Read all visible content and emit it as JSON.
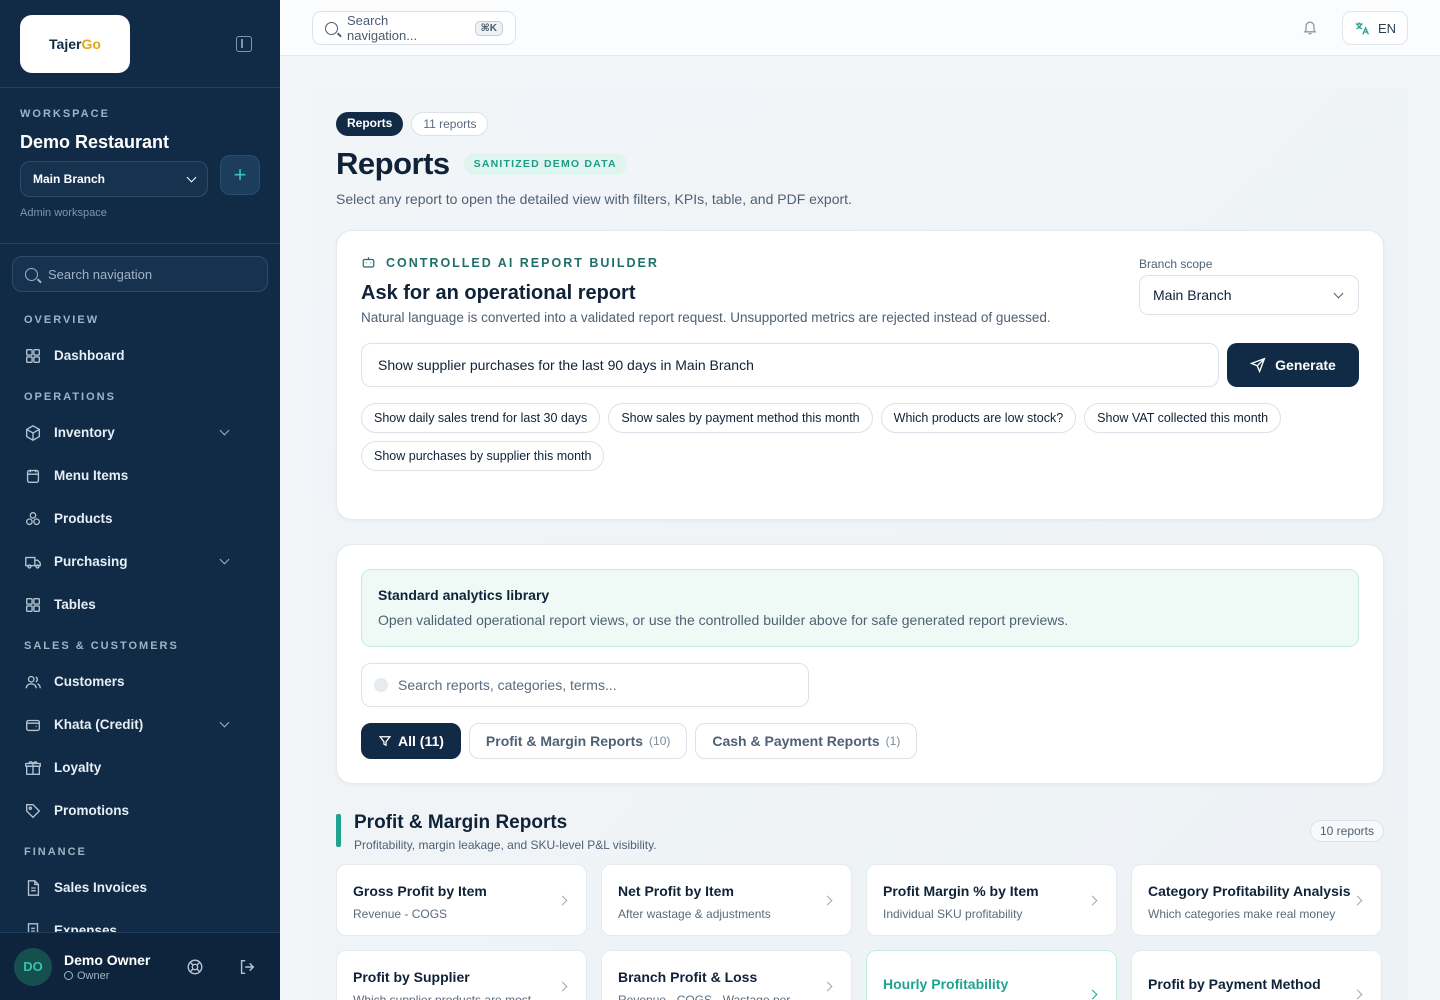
{
  "brand": {
    "logo_text_1": "Tajer",
    "logo_text_2": "Go"
  },
  "workspace": {
    "kicker": "WORKSPACE",
    "name": "Demo Restaurant",
    "branch": "Main Branch",
    "sub": "Admin workspace",
    "search_placeholder": "Search navigation"
  },
  "nav": {
    "sections": [
      {
        "label": "OVERVIEW",
        "items": [
          {
            "label": "Dashboard",
            "icon": "grid-icon"
          }
        ]
      },
      {
        "label": "OPERATIONS",
        "items": [
          {
            "label": "Inventory",
            "icon": "box-icon",
            "expandable": true
          },
          {
            "label": "Menu Items",
            "icon": "menu-icon"
          },
          {
            "label": "Products",
            "icon": "products-icon"
          },
          {
            "label": "Purchasing",
            "icon": "truck-icon",
            "expandable": true
          },
          {
            "label": "Tables",
            "icon": "grid-icon"
          }
        ]
      },
      {
        "label": "SALES & CUSTOMERS",
        "items": [
          {
            "label": "Customers",
            "icon": "users-icon"
          },
          {
            "label": "Khata (Credit)",
            "icon": "wallet-icon",
            "expandable": true
          },
          {
            "label": "Loyalty",
            "icon": "gift-icon"
          },
          {
            "label": "Promotions",
            "icon": "tag-icon"
          }
        ]
      },
      {
        "label": "FINANCE",
        "items": [
          {
            "label": "Sales Invoices",
            "icon": "file-icon"
          },
          {
            "label": "Expenses",
            "icon": "receipt-icon"
          }
        ]
      }
    ]
  },
  "user": {
    "initials": "DO",
    "name": "Demo Owner",
    "role": "Owner"
  },
  "topbar": {
    "search_placeholder": "Search navigation...",
    "shortcut": "⌘K",
    "lang": "EN"
  },
  "header": {
    "chip_reports": "Reports",
    "chip_count": "11 reports",
    "title": "Reports",
    "badge": "SANITIZED DEMO DATA",
    "subtitle": "Select any report to open the detailed view with filters, KPIs, table, and PDF export."
  },
  "builder": {
    "kicker": "CONTROLLED AI REPORT BUILDER",
    "title": "Ask for an operational report",
    "desc": "Natural language is converted into a validated report request. Unsupported metrics are rejected instead of guessed.",
    "scope_label": "Branch scope",
    "scope_value": "Main Branch",
    "prompt_value": "Show supplier purchases for the last 90 days in Main Branch",
    "generate_label": "Generate",
    "suggestions": [
      "Show daily sales trend for last 30 days",
      "Show sales by payment method this month",
      "Which products are low stock?",
      "Show VAT collected this month",
      "Show purchases by supplier this month"
    ]
  },
  "library": {
    "title": "Standard analytics library",
    "desc": "Open validated operational report views, or use the controlled builder above for safe generated report previews.",
    "search_placeholder": "Search reports, categories, terms...",
    "filters": [
      {
        "label": "All (11)",
        "count": "",
        "active": true
      },
      {
        "label": "Profit & Margin Reports",
        "count": "(10)",
        "active": false
      },
      {
        "label": "Cash & Payment Reports",
        "count": "(1)",
        "active": false
      }
    ]
  },
  "section": {
    "title": "Profit & Margin Reports",
    "desc": "Profitability, margin leakage, and SKU-level P&L visibility.",
    "count": "10 reports"
  },
  "reports": [
    {
      "title": "Gross Profit by Item",
      "desc": "Revenue - COGS"
    },
    {
      "title": "Net Profit by Item",
      "desc": "After wastage & adjustments"
    },
    {
      "title": "Profit Margin % by Item",
      "desc": "Individual SKU profitability"
    },
    {
      "title": "Category Profitability Analysis",
      "desc": "Which categories make real money"
    },
    {
      "title": "Profit by Supplier",
      "desc": "Which supplier products are most"
    },
    {
      "title": "Branch Profit & Loss",
      "desc": "Revenue - COGS - Wastage per"
    },
    {
      "title": "Hourly Profitability",
      "desc": "",
      "highlight": true
    },
    {
      "title": "Profit by Payment Method",
      "desc": ""
    }
  ],
  "colors": {
    "sidebar": "#112a45",
    "accent": "#1fa28e",
    "primary_button": "#112a45",
    "logo_go": "#e0a91a"
  }
}
